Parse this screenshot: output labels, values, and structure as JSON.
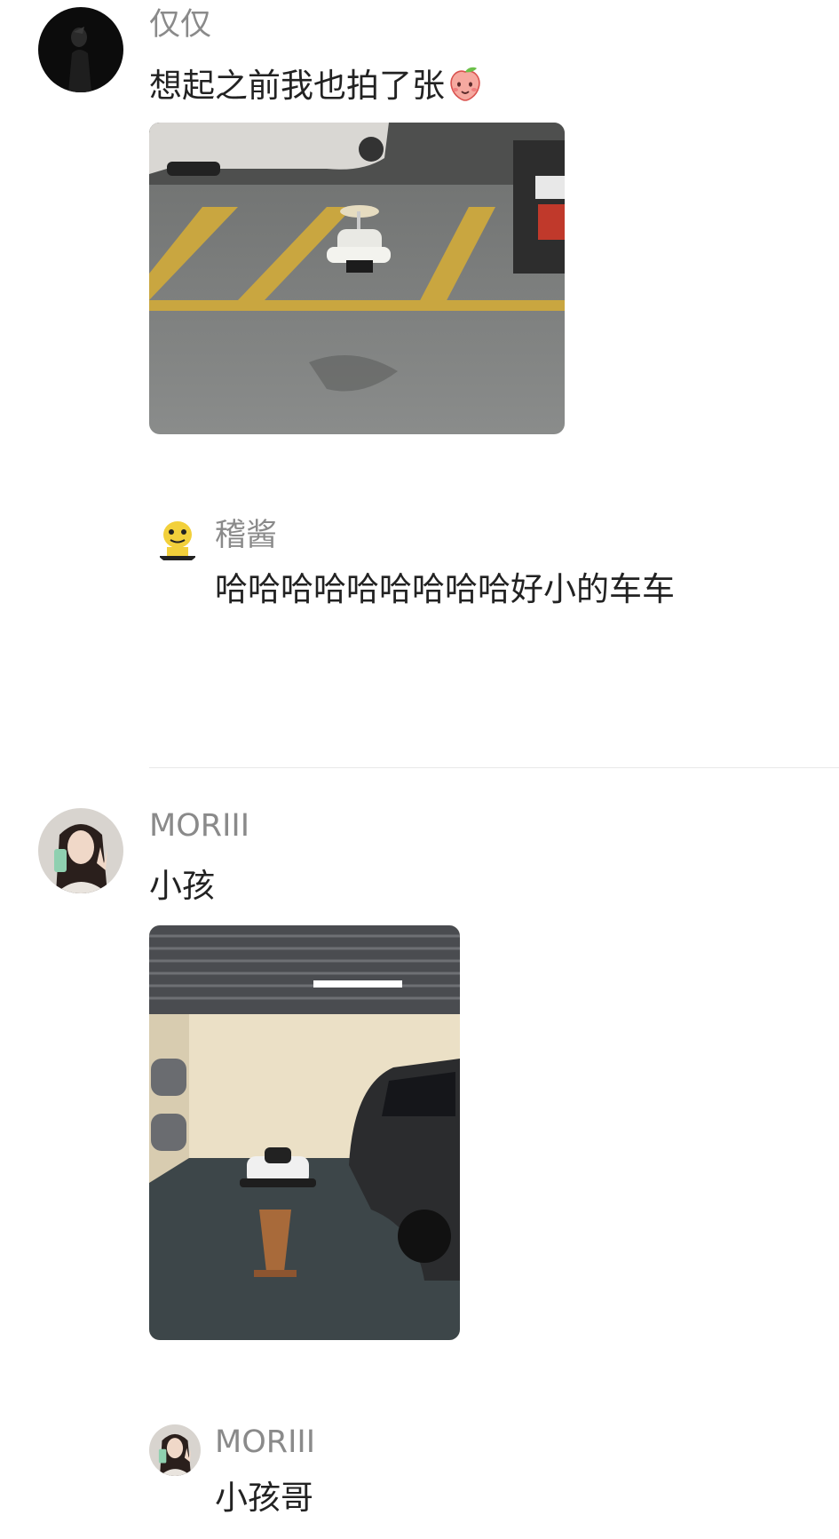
{
  "comments": [
    {
      "user": "仅仅",
      "text": "想起之前我也拍了张",
      "emoji": "peach-emoji",
      "avatar_icon": "dark-silhouette-avatar",
      "image": "parking-lot-toy-car-photo",
      "replies": [
        {
          "user": "稽酱",
          "text": "哈哈哈哈哈哈哈哈哈好小的车车",
          "avatar_icon": "yellow-cartoon-avatar"
        }
      ]
    },
    {
      "user": "MORIII",
      "text": "小孩",
      "avatar_icon": "selfie-girl-avatar",
      "image": "garage-go-kart-photo",
      "replies": [
        {
          "user": "MORIII",
          "text": "小孩哥",
          "avatar_icon": "selfie-girl-avatar"
        }
      ]
    }
  ]
}
